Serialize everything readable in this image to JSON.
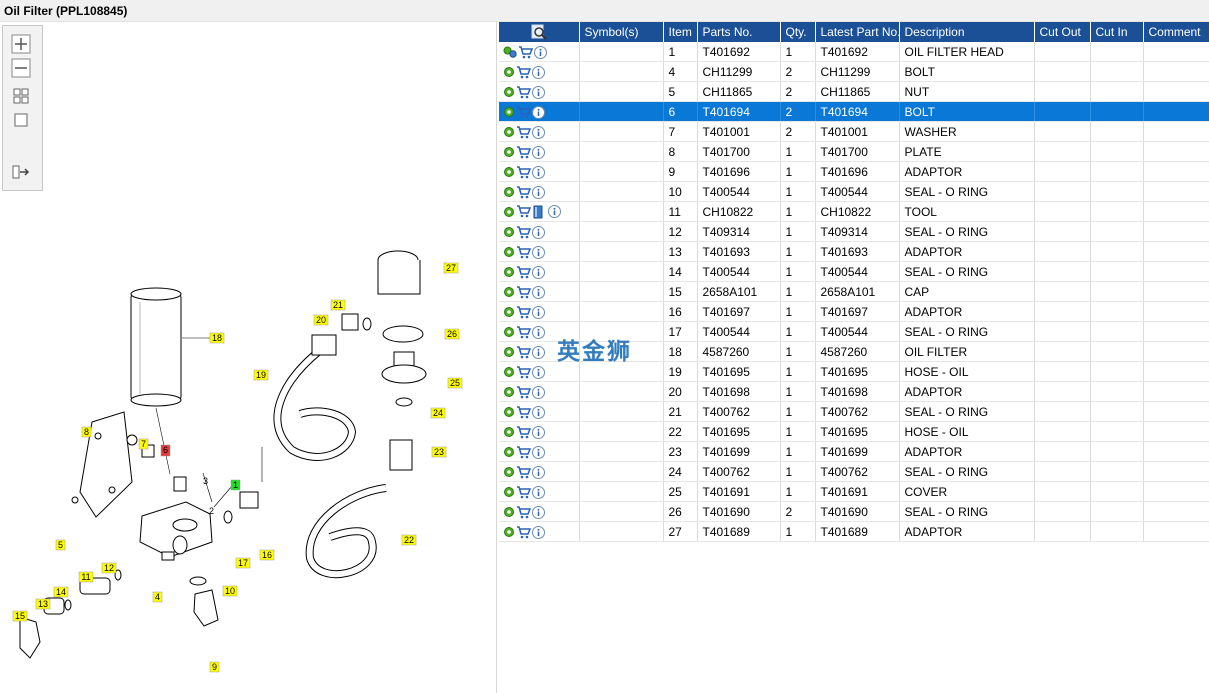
{
  "window": {
    "title": "Oil Filter (PPL108845)"
  },
  "toolbox": {
    "icons": [
      "zoom-in-icon",
      "zoom-out-icon",
      "fit-view-icon",
      "actual-size-icon",
      "export-list-icon"
    ]
  },
  "diagram": {
    "callouts": [
      "1",
      "2",
      "3",
      "4",
      "5",
      "6",
      "7",
      "8",
      "9",
      "10",
      "11",
      "12",
      "13",
      "14",
      "15",
      "16",
      "17",
      "18",
      "19",
      "20",
      "21",
      "22",
      "23",
      "24",
      "25",
      "26",
      "27"
    ],
    "highlighted_callout": "6",
    "current_callout": "1"
  },
  "table": {
    "headers": {
      "symbols": "Symbol(s)",
      "item": "Item",
      "parts_no": "Parts No.",
      "qty": "Qty.",
      "latest": "Latest Part No.",
      "description": "Description",
      "cut_out": "Cut Out",
      "cut_in": "Cut In",
      "comment": "Comment"
    },
    "selected_row": 3,
    "rows": [
      {
        "item": "1",
        "part": "T401692",
        "qty": "1",
        "latest": "T401692",
        "desc": "OIL FILTER HEAD"
      },
      {
        "item": "4",
        "part": "CH11299",
        "qty": "2",
        "latest": "CH11299",
        "desc": "BOLT"
      },
      {
        "item": "5",
        "part": "CH11865",
        "qty": "2",
        "latest": "CH11865",
        "desc": "NUT"
      },
      {
        "item": "6",
        "part": "T401694",
        "qty": "2",
        "latest": "T401694",
        "desc": "BOLT"
      },
      {
        "item": "7",
        "part": "T401001",
        "qty": "2",
        "latest": "T401001",
        "desc": "WASHER"
      },
      {
        "item": "8",
        "part": "T401700",
        "qty": "1",
        "latest": "T401700",
        "desc": "PLATE"
      },
      {
        "item": "9",
        "part": "T401696",
        "qty": "1",
        "latest": "T401696",
        "desc": "ADAPTOR"
      },
      {
        "item": "10",
        "part": "T400544",
        "qty": "1",
        "latest": "T400544",
        "desc": "SEAL - O RING"
      },
      {
        "item": "11",
        "part": "CH10822",
        "qty": "1",
        "latest": "CH10822",
        "desc": "TOOL"
      },
      {
        "item": "12",
        "part": "T409314",
        "qty": "1",
        "latest": "T409314",
        "desc": "SEAL - O RING"
      },
      {
        "item": "13",
        "part": "T401693",
        "qty": "1",
        "latest": "T401693",
        "desc": "ADAPTOR"
      },
      {
        "item": "14",
        "part": "T400544",
        "qty": "1",
        "latest": "T400544",
        "desc": "SEAL - O RING"
      },
      {
        "item": "15",
        "part": "2658A101",
        "qty": "1",
        "latest": "2658A101",
        "desc": "CAP"
      },
      {
        "item": "16",
        "part": "T401697",
        "qty": "1",
        "latest": "T401697",
        "desc": "ADAPTOR"
      },
      {
        "item": "17",
        "part": "T400544",
        "qty": "1",
        "latest": "T400544",
        "desc": "SEAL - O RING"
      },
      {
        "item": "18",
        "part": "4587260",
        "qty": "1",
        "latest": "4587260",
        "desc": "OIL FILTER"
      },
      {
        "item": "19",
        "part": "T401695",
        "qty": "1",
        "latest": "T401695",
        "desc": "HOSE - OIL"
      },
      {
        "item": "20",
        "part": "T401698",
        "qty": "1",
        "latest": "T401698",
        "desc": "ADAPTOR"
      },
      {
        "item": "21",
        "part": "T400762",
        "qty": "1",
        "latest": "T400762",
        "desc": "SEAL - O RING"
      },
      {
        "item": "22",
        "part": "T401695",
        "qty": "1",
        "latest": "T401695",
        "desc": "HOSE - OIL"
      },
      {
        "item": "23",
        "part": "T401699",
        "qty": "1",
        "latest": "T401699",
        "desc": "ADAPTOR"
      },
      {
        "item": "24",
        "part": "T400762",
        "qty": "1",
        "latest": "T400762",
        "desc": "SEAL - O RING"
      },
      {
        "item": "25",
        "part": "T401691",
        "qty": "1",
        "latest": "T401691",
        "desc": "COVER"
      },
      {
        "item": "26",
        "part": "T401690",
        "qty": "2",
        "latest": "T401690",
        "desc": "SEAL - O RING"
      },
      {
        "item": "27",
        "part": "T401689",
        "qty": "1",
        "latest": "T401689",
        "desc": "ADAPTOR"
      }
    ]
  },
  "watermark": {
    "text": "英金狮"
  },
  "colors": {
    "header_bg": "#1b5096",
    "selected_row": "#0a78d7",
    "callout": "#ffff00",
    "callout_highlight": "#e63b3b",
    "callout_current": "#22dd22"
  }
}
